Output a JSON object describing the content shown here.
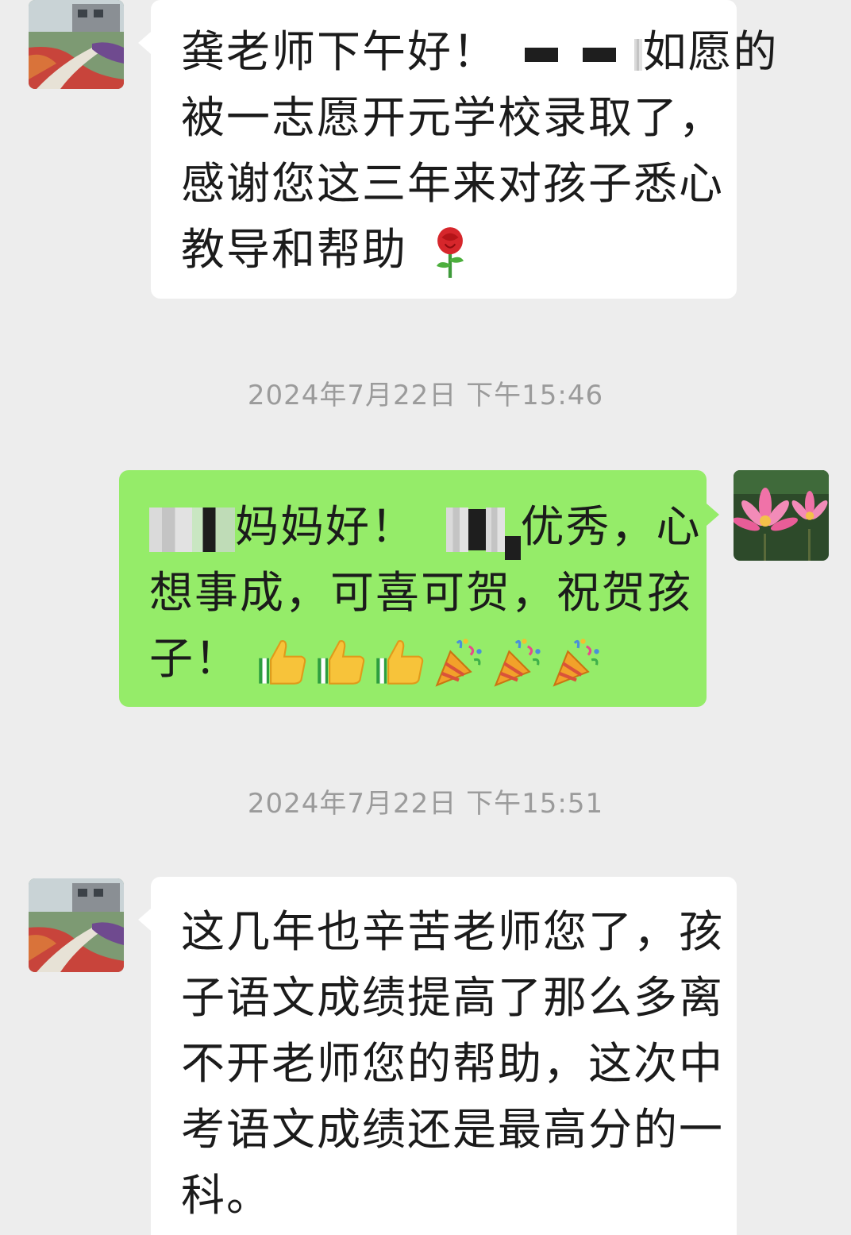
{
  "messages": [
    {
      "id": "msg1",
      "direction": "incoming",
      "sender_avatar": "garden-path-avatar",
      "lines": [
        "龚老师下午好！",
        "如愿的",
        "被一志愿开元学校录取了，",
        "感谢您这三年来对孩子悉心",
        "教导和帮助"
      ],
      "emoji": "rose-icon"
    },
    {
      "id": "msg2",
      "direction": "outgoing",
      "sender_avatar": "lotus-avatar",
      "timestamp": "2024年7月22日 下午15:46",
      "lines": [
        "妈妈好！",
        "优秀，心",
        "想事成，可喜可贺，祝贺孩",
        "子！"
      ],
      "emojis": [
        "thumbs-up-icon",
        "thumbs-up-icon",
        "thumbs-up-icon",
        "party-popper-icon",
        "party-popper-icon",
        "party-popper-icon"
      ]
    },
    {
      "id": "msg3",
      "direction": "incoming",
      "sender_avatar": "garden-path-avatar",
      "timestamp": "2024年7月22日 下午15:51",
      "lines": [
        "这几年也辛苦老师您了，孩",
        "子语文成绩提高了那么多离",
        "不开老师您的帮助，这次中",
        "考语文成绩还是最高分的一",
        "科。"
      ]
    }
  ],
  "colors": {
    "background": "#ededed",
    "incoming_bubble": "#ffffff",
    "outgoing_bubble": "#95ec69",
    "timestamp_text": "#9b9b9b"
  }
}
